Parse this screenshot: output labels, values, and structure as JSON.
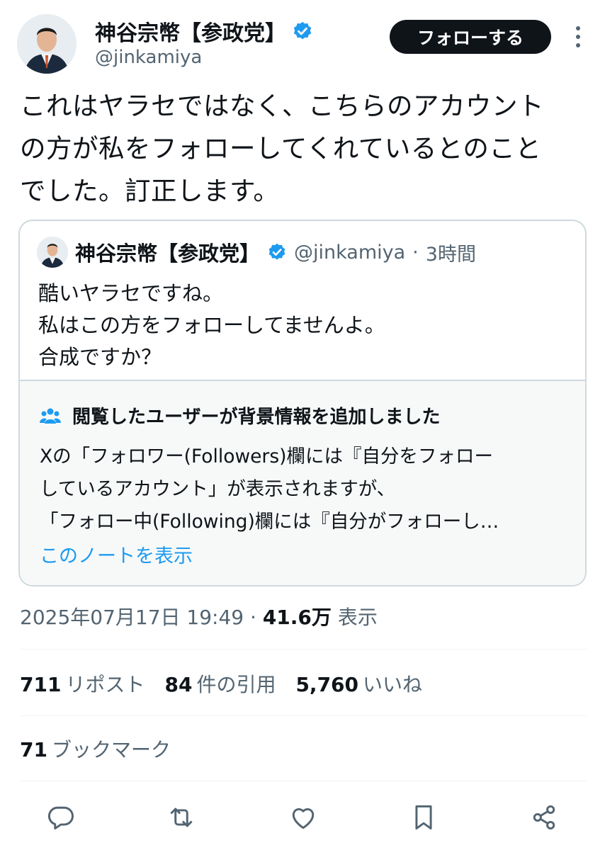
{
  "author": {
    "display_name": "神谷宗幣【参政党】",
    "handle": "@jinkamiya",
    "verified": true
  },
  "follow_button_label": "フォローする",
  "tweet_lines": [
    "これはヤラセではなく、こちらのアカウント",
    "の方が私をフォローしてくれているとのこと",
    "でした。訂正します。"
  ],
  "quote": {
    "display_name": "神谷宗幣【参政党】",
    "handle": "@jinkamiya",
    "separator": "·",
    "time": "3時間",
    "lines": [
      "酷いヤラセですね。",
      "私はこの方をフォローしてませんよ。",
      "合成ですか？"
    ],
    "note": {
      "title": "閲覧したユーザーが背景情報を追加しました",
      "lines": [
        "Xの「フォロワー(Followers)欄には『自分をフォロー",
        "しているアカウント」が表示されますが、",
        "「フォロー中(Following)欄には『自分がフォローし…"
      ],
      "link": "このノートを表示"
    }
  },
  "meta": {
    "timestamp": "2025年07月17日 19:49",
    "separator": "·",
    "views_count": "41.6万",
    "views_label": "表示"
  },
  "stats": {
    "reposts": {
      "num": "711",
      "label": "リポスト"
    },
    "quotes": {
      "num": "84",
      "label": "件の引用"
    },
    "likes": {
      "num": "5,760",
      "label": "いいね"
    }
  },
  "bookmarks": {
    "num": "71",
    "label": "ブックマーク"
  },
  "icons": {
    "verified": "verified-badge-icon",
    "more": "more-vertical-icon",
    "note": "community-notes-icon",
    "actions": [
      "reply-icon",
      "repost-icon",
      "like-icon",
      "bookmark-icon",
      "share-icon"
    ]
  },
  "colors": {
    "accent": "#1d9bf0",
    "text": "#0f1419",
    "muted": "#536471",
    "border": "#cfd9de",
    "note_bg": "#f7f9f9",
    "button_bg": "#0f1419"
  }
}
